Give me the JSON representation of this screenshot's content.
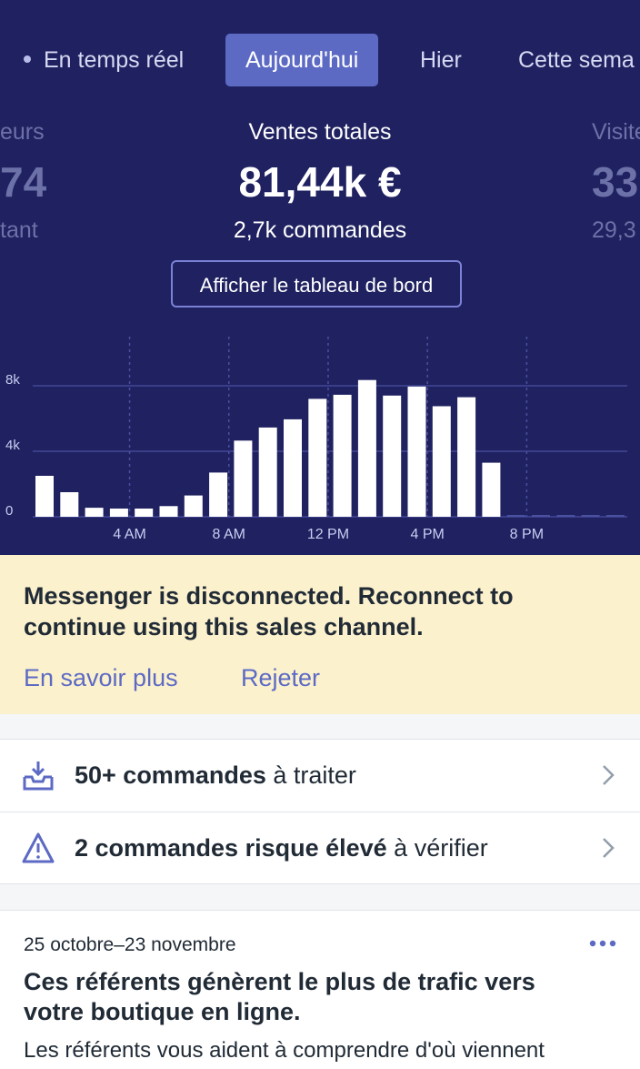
{
  "tabs": [
    {
      "label": "En temps réel",
      "active": false
    },
    {
      "label": "Aujourd'hui",
      "active": true
    },
    {
      "label": "Hier",
      "active": false
    },
    {
      "label": "Cette sema",
      "active": false
    }
  ],
  "stats": {
    "left": {
      "label": "eurs",
      "value": "74",
      "sub": "tant"
    },
    "center": {
      "label": "Ventes totales",
      "value": "81,44k €",
      "sub": "2,7k commandes"
    },
    "right": {
      "label": "Visite",
      "value": "33",
      "sub": "29,3"
    }
  },
  "dashboard_button": "Afficher le tableau de bord",
  "chart_data": {
    "type": "bar",
    "title": "",
    "xlabel": "",
    "ylabel": "",
    "ylim": [
      0,
      11000
    ],
    "y_ticks": [
      0,
      4000,
      8000
    ],
    "y_tick_labels": [
      "0",
      "4k",
      "8k"
    ],
    "x_tick_labels": [
      "4 AM",
      "8 AM",
      "12 PM",
      "4 PM",
      "8 PM"
    ],
    "x_tick_hours": [
      4,
      8,
      12,
      16,
      20
    ],
    "categories": [
      "0h",
      "1h",
      "2h",
      "3h",
      "4h",
      "5h",
      "6h",
      "7h",
      "8h",
      "9h",
      "10h",
      "11h",
      "12h",
      "13h",
      "14h",
      "15h",
      "16h",
      "17h",
      "18h",
      "19h",
      "20h",
      "21h",
      "22h",
      "23h"
    ],
    "values": [
      2500,
      1500,
      550,
      500,
      500,
      650,
      1300,
      2700,
      4650,
      5450,
      5950,
      7200,
      7450,
      8350,
      7400,
      7950,
      6750,
      7300,
      3300,
      0,
      0,
      0,
      0,
      0
    ],
    "grid": true,
    "colors": {
      "bar": "#ffffff",
      "grid": "#4a50a0",
      "tick_label": "#c9cdf0"
    }
  },
  "banner": {
    "message": "Messenger is disconnected. Reconnect to continue using this sales channel.",
    "learn_more": "En savoir plus",
    "dismiss": "Rejeter"
  },
  "tasks": [
    {
      "bold": "50+ commandes",
      "rest": " à traiter",
      "icon": "inbox-download-icon"
    },
    {
      "bold": "2 commandes risque élevé",
      "rest": " à vérifier",
      "icon": "warning-triangle-icon"
    }
  ],
  "insight": {
    "date_range": "25 octobre–23 novembre",
    "title": "Ces référents génèrent le plus de trafic vers votre boutique en ligne.",
    "body": "Les référents vous aident à comprendre d'où viennent"
  },
  "colors": {
    "hero_bg": "#1f2160",
    "accent": "#5c6ac4",
    "banner_bg": "#fcf1cd",
    "text": "#212b36"
  }
}
